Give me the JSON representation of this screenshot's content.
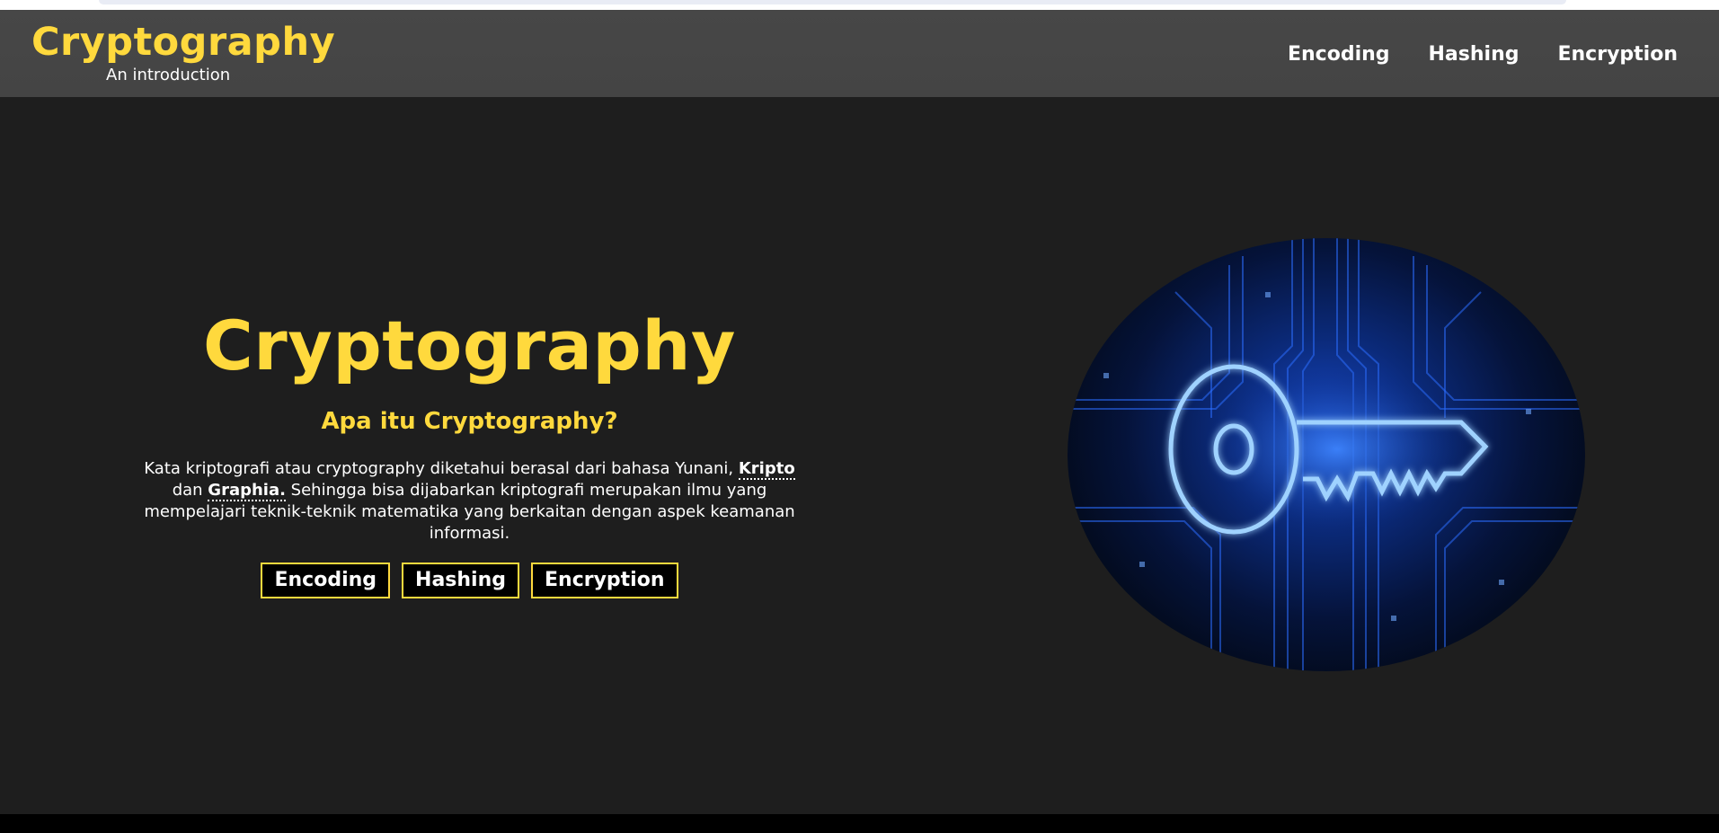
{
  "header": {
    "brand_title": "Cryptography",
    "brand_subtitle": "An introduction",
    "nav": [
      {
        "label": "Encoding"
      },
      {
        "label": "Hashing"
      },
      {
        "label": "Encryption"
      }
    ]
  },
  "hero": {
    "title": "Cryptography",
    "subtitle": "Apa itu Cryptography?",
    "text_before": "Kata kriptografi atau cryptography diketahui berasal dari bahasa Yunani, ",
    "term1": "Kripto",
    "text_mid": " dan ",
    "term2": "Graphia.",
    "text_after": " Sehingga bisa dijabarkan kriptografi merupakan ilmu yang mempelajari teknik-teknik matematika yang berkaitan dengan aspek keamanan informasi.",
    "buttons": [
      {
        "label": "Encoding"
      },
      {
        "label": "Hashing"
      },
      {
        "label": "Encryption"
      }
    ],
    "image_icon": "digital-key-icon"
  },
  "colors": {
    "accent": "#ffd93d",
    "header_bg": "#474747",
    "page_bg": "#1e1e1e",
    "footer_bg": "#000000",
    "image_glow": "#1e6bff"
  }
}
